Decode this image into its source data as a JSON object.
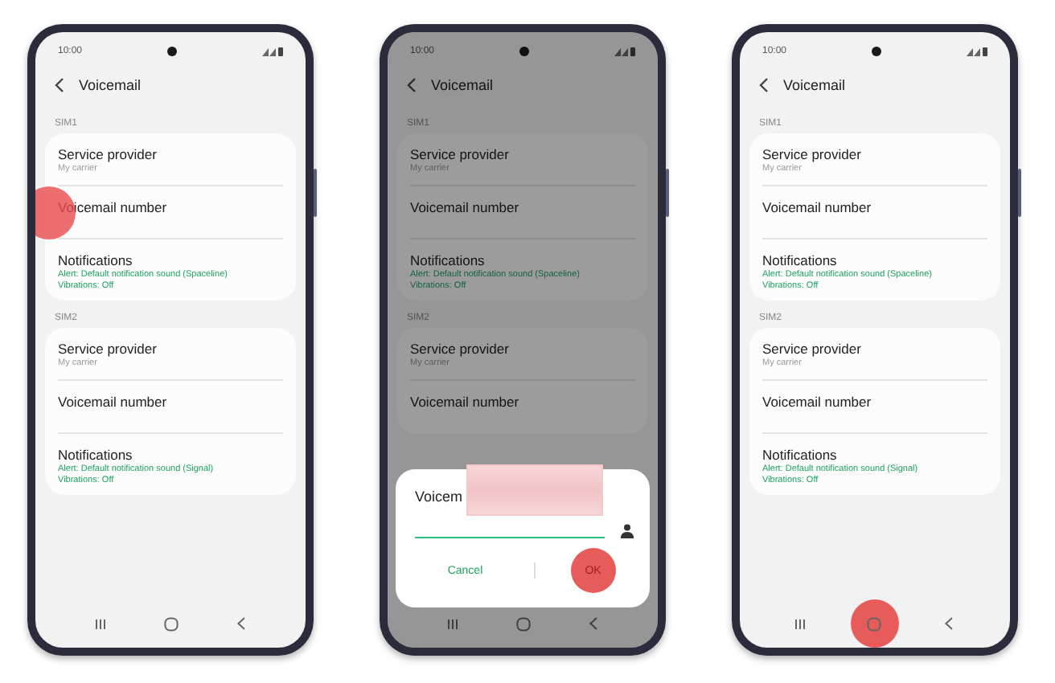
{
  "phones": [
    {
      "status_time": "10:00",
      "title": "Voicemail",
      "dimmed": false,
      "sections": [
        {
          "label": "SIM1",
          "items": [
            {
              "title": "Service provider",
              "subtitle": "My carrier",
              "kind": "info",
              "tapped": false
            },
            {
              "title": "Voicemail number",
              "kind": "info",
              "tapped": true
            },
            {
              "title": "Notifications",
              "subtitle": "Alert: Default notification sound (Spaceline)",
              "subtitle_2": "Vibrations: Off",
              "kind": "notification",
              "tapped": false
            }
          ]
        },
        {
          "label": "SIM2",
          "items": [
            {
              "title": "Service provider",
              "subtitle": "My carrier",
              "kind": "info",
              "tapped": false
            },
            {
              "title": "Voicemail number",
              "kind": "info",
              "tapped": false
            },
            {
              "title": "Notifications",
              "subtitle": "Alert: Default notification sound (Signal)",
              "subtitle_2": "Vibrations: Off",
              "kind": "notification",
              "tapped": false
            }
          ]
        }
      ],
      "nav": [
        {
          "kind": "recents",
          "tapped": false
        },
        {
          "kind": "home",
          "tapped": false
        },
        {
          "kind": "back",
          "tapped": false
        }
      ]
    },
    {
      "status_time": "10:00",
      "title": "Voicemail",
      "dimmed": true,
      "sections": [
        {
          "label": "SIM1",
          "items": [
            {
              "title": "Service provider",
              "subtitle": "My carrier",
              "kind": "info",
              "tapped": false
            },
            {
              "title": "Voicemail number",
              "kind": "info",
              "tapped": false
            },
            {
              "title": "Notifications",
              "subtitle": "Alert: Default notification sound (Spaceline)",
              "subtitle_2": "Vibrations: Off",
              "kind": "notification",
              "tapped": false
            }
          ]
        },
        {
          "label": "SIM2",
          "items": [
            {
              "title": "Service provider",
              "subtitle": "My carrier",
              "kind": "info",
              "tapped": false
            },
            {
              "title": "Voicemail number",
              "kind": "info",
              "tapped": false
            }
          ]
        }
      ],
      "dialog": {
        "title": "Voicem",
        "cancel": "Cancel",
        "ok": "OK",
        "ok_tapped": true
      },
      "nav": [
        {
          "kind": "recents",
          "tapped": false
        },
        {
          "kind": "home",
          "tapped": false
        },
        {
          "kind": "back",
          "tapped": false
        }
      ]
    },
    {
      "status_time": "10:00",
      "title": "Voicemail",
      "dimmed": false,
      "sections": [
        {
          "label": "SIM1",
          "items": [
            {
              "title": "Service provider",
              "subtitle": "My carrier",
              "kind": "info",
              "tapped": false
            },
            {
              "title": "Voicemail number",
              "kind": "info",
              "tapped": false
            },
            {
              "title": "Notifications",
              "subtitle": "Alert: Default notification sound (Spaceline)",
              "subtitle_2": "Vibrations: Off",
              "kind": "notification",
              "tapped": false
            }
          ]
        },
        {
          "label": "SIM2",
          "items": [
            {
              "title": "Service provider",
              "subtitle": "My carrier",
              "kind": "info",
              "tapped": false
            },
            {
              "title": "Voicemail number",
              "kind": "info",
              "tapped": false
            },
            {
              "title": "Notifications",
              "subtitle": "Alert: Default notification sound (Signal)",
              "subtitle_2": "Vibrations: Off",
              "kind": "notification",
              "tapped": false
            }
          ]
        }
      ],
      "nav": [
        {
          "kind": "recents",
          "tapped": false
        },
        {
          "kind": "home",
          "tapped": true
        },
        {
          "kind": "back",
          "tapped": false
        }
      ]
    }
  ]
}
